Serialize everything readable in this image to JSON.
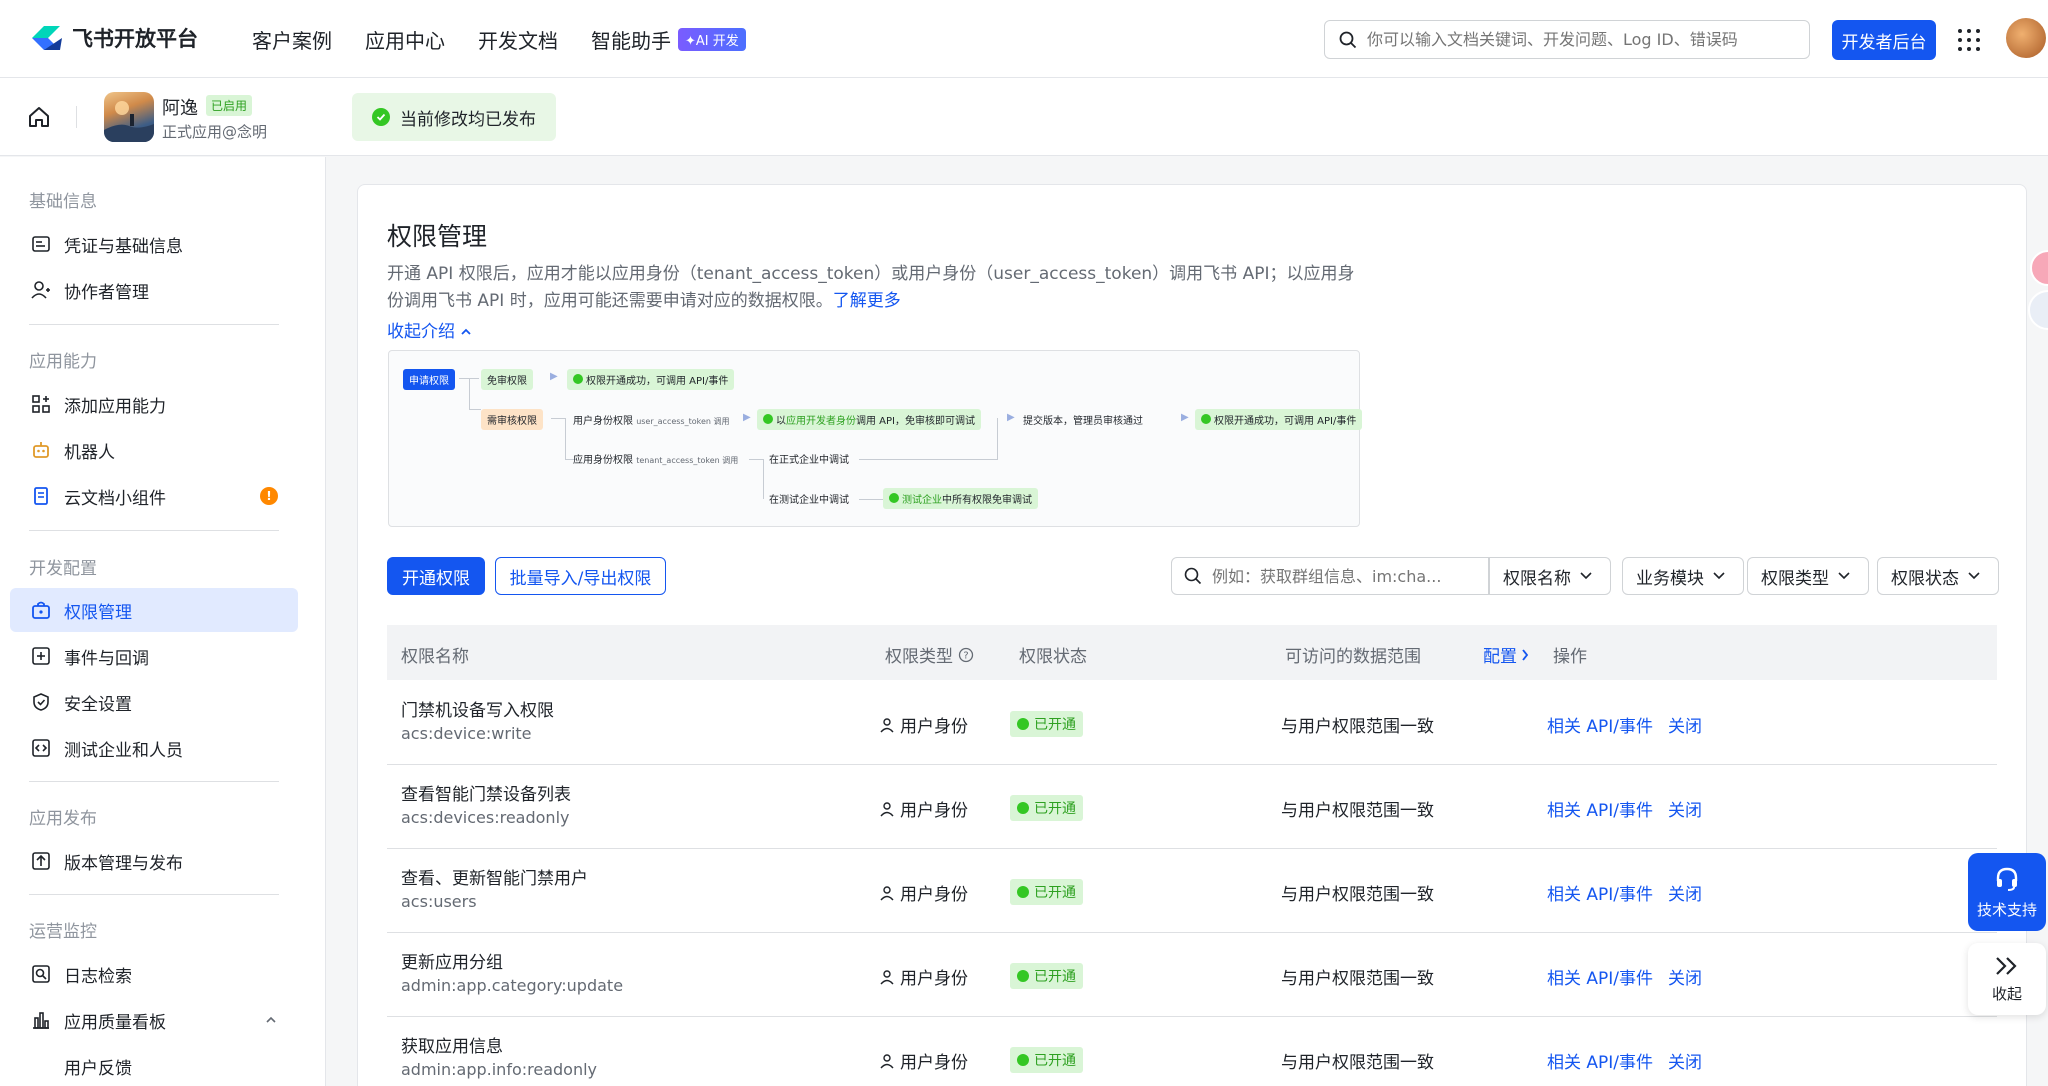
{
  "topnav": {
    "logo": "飞书开放平台",
    "items": [
      "客户案例",
      "应用中心",
      "开发文档",
      "智能助手"
    ],
    "ai_badge": "✦AI 开发",
    "search_placeholder": "你可以输入文档关键词、开发问题、Log ID、错误码",
    "dev_button": "开发者后台"
  },
  "appbar": {
    "app_name": "阿逸",
    "app_status": "已启用",
    "app_sub": "正式应用@念明",
    "publish_tip": "当前修改均已发布"
  },
  "sidebar": {
    "groups": [
      "基础信息",
      "应用能力",
      "开发配置",
      "应用发布",
      "运营监控"
    ],
    "items": [
      {
        "label": "凭证与基础信息",
        "icon": "credential-icon"
      },
      {
        "label": "协作者管理",
        "icon": "user-plus-icon"
      },
      {
        "label": "添加应用能力",
        "icon": "apps-add-icon"
      },
      {
        "label": "机器人",
        "icon": "robot-icon"
      },
      {
        "label": "云文档小组件",
        "icon": "doc-widget-icon",
        "badge": "!"
      },
      {
        "label": "权限管理",
        "icon": "permission-icon"
      },
      {
        "label": "事件与回调",
        "icon": "event-icon"
      },
      {
        "label": "安全设置",
        "icon": "shield-icon"
      },
      {
        "label": "测试企业和人员",
        "icon": "code-icon"
      },
      {
        "label": "版本管理与发布",
        "icon": "upload-icon"
      },
      {
        "label": "日志检索",
        "icon": "log-search-icon"
      },
      {
        "label": "应用质量看板",
        "icon": "bar-chart-icon"
      },
      {
        "label": "用户反馈",
        "icon": ""
      }
    ]
  },
  "main": {
    "title": "权限管理",
    "desc_1": "开通 API 权限后，应用才能以应用身份（tenant_access_token）或用户身份（user_access_token）调用飞书 API；以应用身份调",
    "desc_2": "用飞书 API 时，应用可能还需要申请对应的数据权限。",
    "learn_more": "了解更多",
    "collapse": "收起介绍",
    "flow": {
      "apply": "申请权限",
      "free": "免审权限",
      "free_result": "权限开通成功，可调用 API/事件",
      "review": "需审核权限",
      "user_perm": "用户身份权限",
      "user_token": "user_access_token 调用",
      "dev_call_prefix": "以",
      "dev_call_hl": "应用开发者身份",
      "dev_call_suffix": "调用 API，免审核即可调试",
      "submit": "提交版本，管理员审核通过",
      "final_result": "权限开通成功，可调用 API/事件",
      "app_perm": "应用身份权限",
      "tenant_token": "tenant_access_token 调用",
      "prod_debug": "在正式企业中调试",
      "test_debug": "在测试企业中调试",
      "test_free_hl": "测试企业",
      "test_free_suffix": "中所有权限免审调试"
    },
    "open_button": "开通权限",
    "batch_button": "批量导入/导出权限",
    "filter_placeholder": "例如：获取群组信息、im:cha...",
    "filters": [
      "权限名称",
      "业务模块",
      "权限类型",
      "权限状态"
    ],
    "columns": [
      "权限名称",
      "权限类型",
      "权限状态",
      "可访问的数据范围",
      "配置",
      "操作"
    ],
    "rows": [
      {
        "name": "门禁机设备写入权限",
        "code": "acs:device:write",
        "type": "用户身份",
        "status": "已开通",
        "scope": "与用户权限范围一致",
        "api": "相关 API/事件",
        "close": "关闭"
      },
      {
        "name": "查看智能门禁设备列表",
        "code": "acs:devices:readonly",
        "type": "用户身份",
        "status": "已开通",
        "scope": "与用户权限范围一致",
        "api": "相关 API/事件",
        "close": "关闭"
      },
      {
        "name": "查看、更新智能门禁用户",
        "code": "acs:users",
        "type": "用户身份",
        "status": "已开通",
        "scope": "与用户权限范围一致",
        "api": "相关 API/事件",
        "close": "关闭"
      },
      {
        "name": "更新应用分组",
        "code": "admin:app.category:update",
        "type": "用户身份",
        "status": "已开通",
        "scope": "与用户权限范围一致",
        "api": "相关 API/事件",
        "close": "关闭"
      },
      {
        "name": "获取应用信息",
        "code": "admin:app.info:readonly",
        "type": "用户身份",
        "status": "已开通",
        "scope": "与用户权限范围一致",
        "api": "相关 API/事件",
        "close": "关闭"
      }
    ]
  },
  "floating": {
    "support": "技术支持",
    "collapse": "收起"
  },
  "colors": {
    "primary": "#1456f0",
    "success": "#2ea121",
    "success_bg": "#d9f5d6",
    "warning": "#ff8800"
  }
}
